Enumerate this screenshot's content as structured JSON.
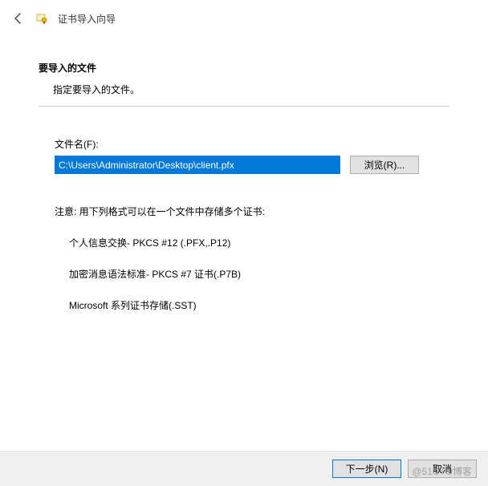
{
  "header": {
    "title": "证书导入向导"
  },
  "section": {
    "title": "要导入的文件",
    "description": "指定要导入的文件。"
  },
  "file": {
    "label": "文件名(F):",
    "value": "C:\\Users\\Administrator\\Desktop\\client.pfx",
    "browse_label": "浏览(R)..."
  },
  "note": "注意: 用下列格式可以在一个文件中存储多个证书:",
  "formats": {
    "item1": "个人信息交换- PKCS #12 (.PFX,.P12)",
    "item2": "加密消息语法标准- PKCS #7 证书(.P7B)",
    "item3": "Microsoft 系列证书存储(.SST)"
  },
  "footer": {
    "next_label": "下一步(N)",
    "cancel_label": "取消"
  },
  "watermark": "@51CTO博客"
}
